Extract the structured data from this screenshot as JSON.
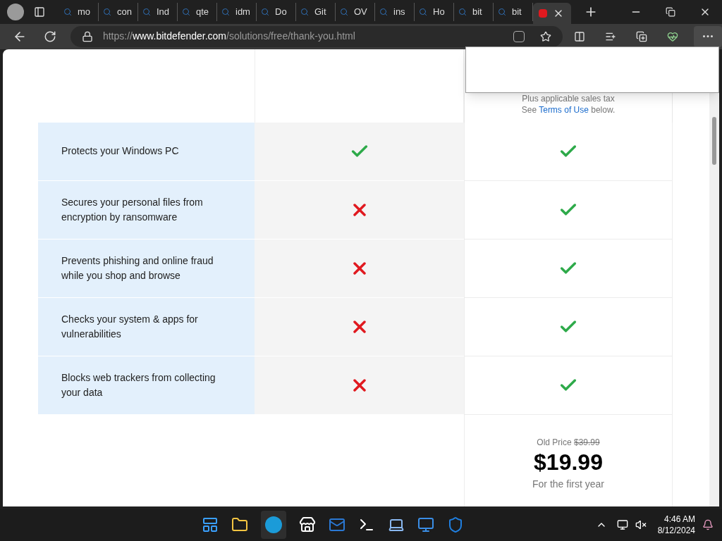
{
  "browser": {
    "tabs": [
      {
        "label": "mo",
        "selected": false
      },
      {
        "label": "con",
        "selected": false
      },
      {
        "label": "Ind",
        "selected": false
      },
      {
        "label": "qte",
        "selected": false
      },
      {
        "label": "idm",
        "selected": false
      },
      {
        "label": "Do",
        "selected": false
      },
      {
        "label": "Git",
        "selected": false
      },
      {
        "label": "OV",
        "selected": false
      },
      {
        "label": "ins",
        "selected": false
      },
      {
        "label": "Ho",
        "selected": false
      },
      {
        "label": "bit",
        "selected": false
      },
      {
        "label": "bit",
        "selected": false
      },
      {
        "selected": true
      }
    ],
    "address": {
      "scheme": "https://",
      "host": "www.bitdefender.com",
      "path": "/solutions/free/thank-you.html"
    }
  },
  "comparison": {
    "tax_note": "Plus applicable sales tax",
    "terms": {
      "before": "See ",
      "link": "Terms of Use",
      "after": " below."
    },
    "rows": [
      {
        "feature": "Protects your Windows PC",
        "free_included": true,
        "premium_included": true
      },
      {
        "feature": "Secures your personal files from encryption by ransomware",
        "free_included": false,
        "premium_included": true
      },
      {
        "feature": "Prevents phishing and online fraud while you shop and browse",
        "free_included": false,
        "premium_included": true
      },
      {
        "feature": "Checks your system & apps for vulnerabilities",
        "free_included": false,
        "premium_included": true
      },
      {
        "feature": "Blocks web trackers from collecting your data",
        "free_included": false,
        "premium_included": true
      }
    ],
    "price": {
      "old_label": "Old Price ",
      "old_price": "$39.99",
      "price": "$19.99",
      "period": "For the first year"
    }
  },
  "taskbar": {
    "time": "4:46 AM",
    "date": "8/12/2024"
  }
}
